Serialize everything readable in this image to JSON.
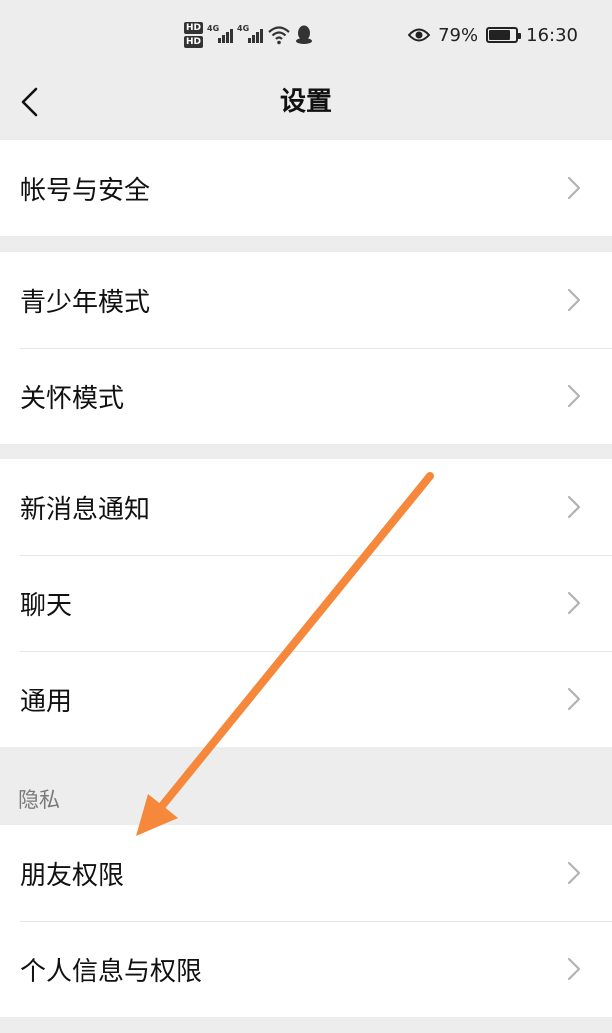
{
  "status_bar": {
    "net1": "4G",
    "net2": "4G",
    "battery_percent_text": "79%",
    "battery_level": 0.79,
    "time": "16:30",
    "icons": [
      "hd-icon",
      "signal-icon",
      "wifi-icon",
      "qq-icon",
      "eye-icon",
      "battery-icon"
    ]
  },
  "nav": {
    "title": "设置"
  },
  "groups": {
    "account": {
      "items": [
        "帐号与安全"
      ]
    },
    "modes": {
      "items": [
        "青少年模式",
        "关怀模式"
      ]
    },
    "general": {
      "items": [
        "新消息通知",
        "聊天",
        "通用"
      ]
    },
    "privacy": {
      "header": "隐私",
      "items": [
        "朋友权限",
        "个人信息与权限"
      ]
    }
  },
  "colors": {
    "background": "#ededed",
    "card": "#ffffff",
    "annotation_arrow": "#f5883a"
  }
}
